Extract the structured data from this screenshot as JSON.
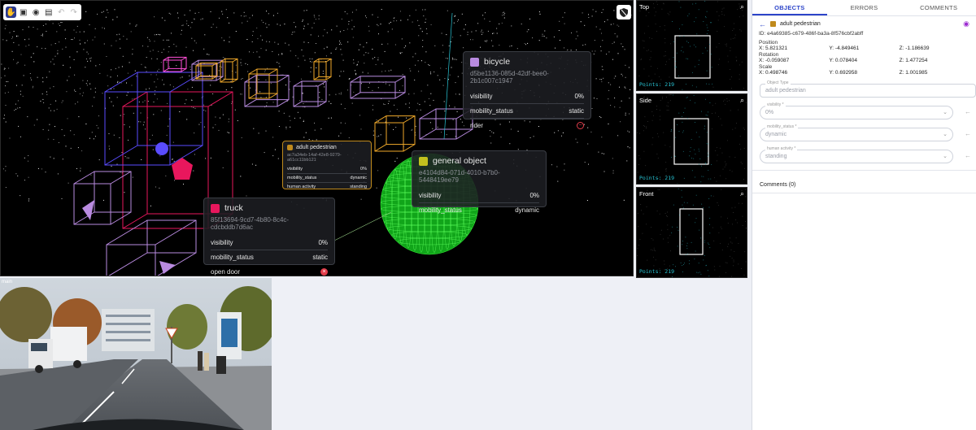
{
  "colors": {
    "accent": "#2d45c9",
    "truck": "#e8175d",
    "bicycle": "#b98be0",
    "general_object": "#c2c21e",
    "pedestrian": "#c08a1c",
    "points_label": "#27c6d6"
  },
  "toolbar": {
    "icons": [
      "hand-pointer-icon",
      "box-icon",
      "target-icon",
      "image-icon",
      "undo-icon",
      "redo-icon"
    ]
  },
  "cards": {
    "bicycle": {
      "title": "bicycle",
      "id": "d5be1136-085d-42df-bee0-2b1c007c1947",
      "rows": [
        {
          "label": "visibility",
          "value": "0%"
        },
        {
          "label": "mobility_status",
          "value": "static"
        },
        {
          "label": "rider",
          "value": ""
        }
      ]
    },
    "pedestrian": {
      "title": "adult pedestrian",
      "id": "ac7a34eb-14af-42e8-9279-a61cc11bb121",
      "rows": [
        {
          "label": "visibility",
          "value": "0%"
        },
        {
          "label": "mobility_status",
          "value": "dynamic"
        },
        {
          "label": "human activity",
          "value": "standing"
        }
      ]
    },
    "general": {
      "title": "general object",
      "id": "e4104d84-071d-4010-b7b0-5448419ee79",
      "rows": [
        {
          "label": "visibility",
          "value": "0%"
        },
        {
          "label": "mobility_status",
          "value": "dynamic"
        }
      ]
    },
    "truck": {
      "title": "truck",
      "id": "85f13694-9cd7-4b80-8c4c-cdcbddb7d6ac",
      "rows": [
        {
          "label": "visibility",
          "value": "0%"
        },
        {
          "label": "mobility_status",
          "value": "static"
        },
        {
          "label": "open door",
          "value": ""
        }
      ]
    }
  },
  "views": {
    "top": {
      "label": "Top",
      "points": "Points: 219"
    },
    "side": {
      "label": "Side",
      "points": "Points: 219"
    },
    "front": {
      "label": "Front",
      "points": "Points: 219"
    }
  },
  "camera": {
    "label": "main"
  },
  "panel": {
    "tabs": [
      "OBJECTS",
      "ERRORS",
      "COMMENTS"
    ],
    "object_name": "adult pedestrian",
    "id_line": "ID: e4a69385-c679-486f-ba3a-8f576cbf2abff",
    "position": {
      "label": "Position",
      "x": "X: 5.821321",
      "y": "Y: -4.849461",
      "z": "Z: -1.186639"
    },
    "rotation": {
      "label": "Rotation",
      "x": "X: -0.059087",
      "y": "Y: 0.078404",
      "z": "Z: 1.477254"
    },
    "scale": {
      "label": "Scale",
      "x": "X: 0.498746",
      "y": "Y: 0.692958",
      "z": "Z: 1.001985"
    },
    "fields": [
      {
        "label": "Object Type",
        "value": "adult pedestrian"
      },
      {
        "label": "visibility *",
        "value": "0%"
      },
      {
        "label": "mobility_status *",
        "value": "dynamic"
      },
      {
        "label": "human activity *",
        "value": "standing"
      }
    ],
    "comments": "Comments (0)"
  }
}
